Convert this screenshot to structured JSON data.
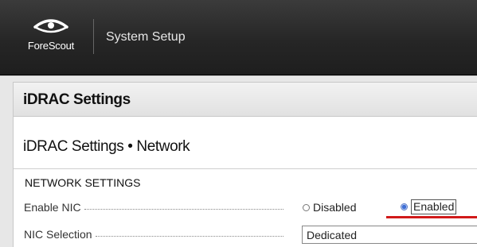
{
  "header": {
    "brand": "ForeScout",
    "app_title": "System Setup"
  },
  "panel": {
    "title": "iDRAC Settings",
    "page_heading": "iDRAC Settings • Network"
  },
  "network": {
    "section_title": "NETWORK SETTINGS",
    "enable_nic": {
      "label": "Enable NIC",
      "options": [
        "Disabled",
        "Enabled"
      ],
      "selected": "Enabled"
    },
    "nic_selection": {
      "label": "NIC Selection",
      "value": "Dedicated"
    }
  },
  "colors": {
    "header_bg": "#262626",
    "highlight": "#d11a1a",
    "radio_selected": "#3f6fd6"
  }
}
